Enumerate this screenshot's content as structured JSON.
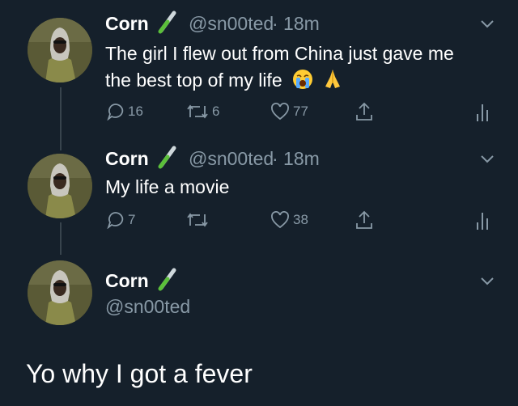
{
  "tweets": [
    {
      "name": "Corn",
      "handle": "@sn00ted",
      "time": "· 18m",
      "text_line1": "The girl I flew out from China just gave me",
      "text_line2": "the best top of my life",
      "emojis": [
        "loudly-crying-face",
        "folded-hands"
      ],
      "replies": "16",
      "retweets": "6",
      "likes": "77"
    },
    {
      "name": "Corn",
      "handle": "@sn00ted",
      "time": "· 18m",
      "text": "My life a movie",
      "replies": "7",
      "retweets": "",
      "likes": "38"
    },
    {
      "name": "Corn",
      "handle": "@sn00ted"
    }
  ],
  "caption": "Yo why I got a fever",
  "colors": {
    "background": "#15202b",
    "muted": "#8899a6",
    "thread_line": "#38444d",
    "test_tube_green": "#5bbf3a"
  },
  "icons": [
    "reply-icon",
    "retweet-icon",
    "like-icon",
    "share-icon",
    "analytics-icon",
    "chevron-down-icon",
    "test-tube-icon"
  ]
}
